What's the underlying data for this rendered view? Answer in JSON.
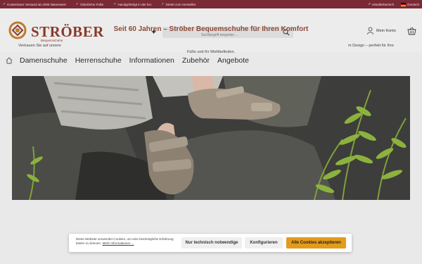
{
  "topbar": {
    "usps": [
      "Kostenloser Versand ab 200€ Warenwert",
      "Glückliche Füße",
      "Handgefertigt in der EU",
      "Direkt vom Hersteller"
    ],
    "dealer_label": "Händlerbereich",
    "language_label": "Deutsch"
  },
  "header": {
    "brand": "STRÖBER",
    "brand_sub": "Bequemschuhe",
    "search_placeholder": "Suchbegriff eingeben ...",
    "account_label": "Mein Konto"
  },
  "nav": {
    "items": [
      "Damenschuhe",
      "Herrenschuhe",
      "Informationen",
      "Zubehör",
      "Angebote"
    ]
  },
  "content": {
    "headline": "Seit 60 Jahren – Ströber Bequemschuhe für Ihren Komfort",
    "intro_line1_start": "Vertrauen Sie auf unsere",
    "intro_line1_end": "m Design – perfekt für Ihre",
    "intro_line2": "Füße und Ihr Wohlbefinden."
  },
  "cookie": {
    "text": "Diese Website verwendet Cookies, um eine bestmögliche Erfahrung bieten zu können.",
    "link": "Mehr Informationen ...",
    "btn_technical": "Nur technisch notwendige",
    "btn_configure": "Konfigurieren",
    "btn_accept": "Alle Cookies akzeptieren"
  },
  "colors": {
    "topbar_bg": "#7a2a35",
    "brand": "#8a3a2a",
    "accept_button": "#e39b1b"
  }
}
